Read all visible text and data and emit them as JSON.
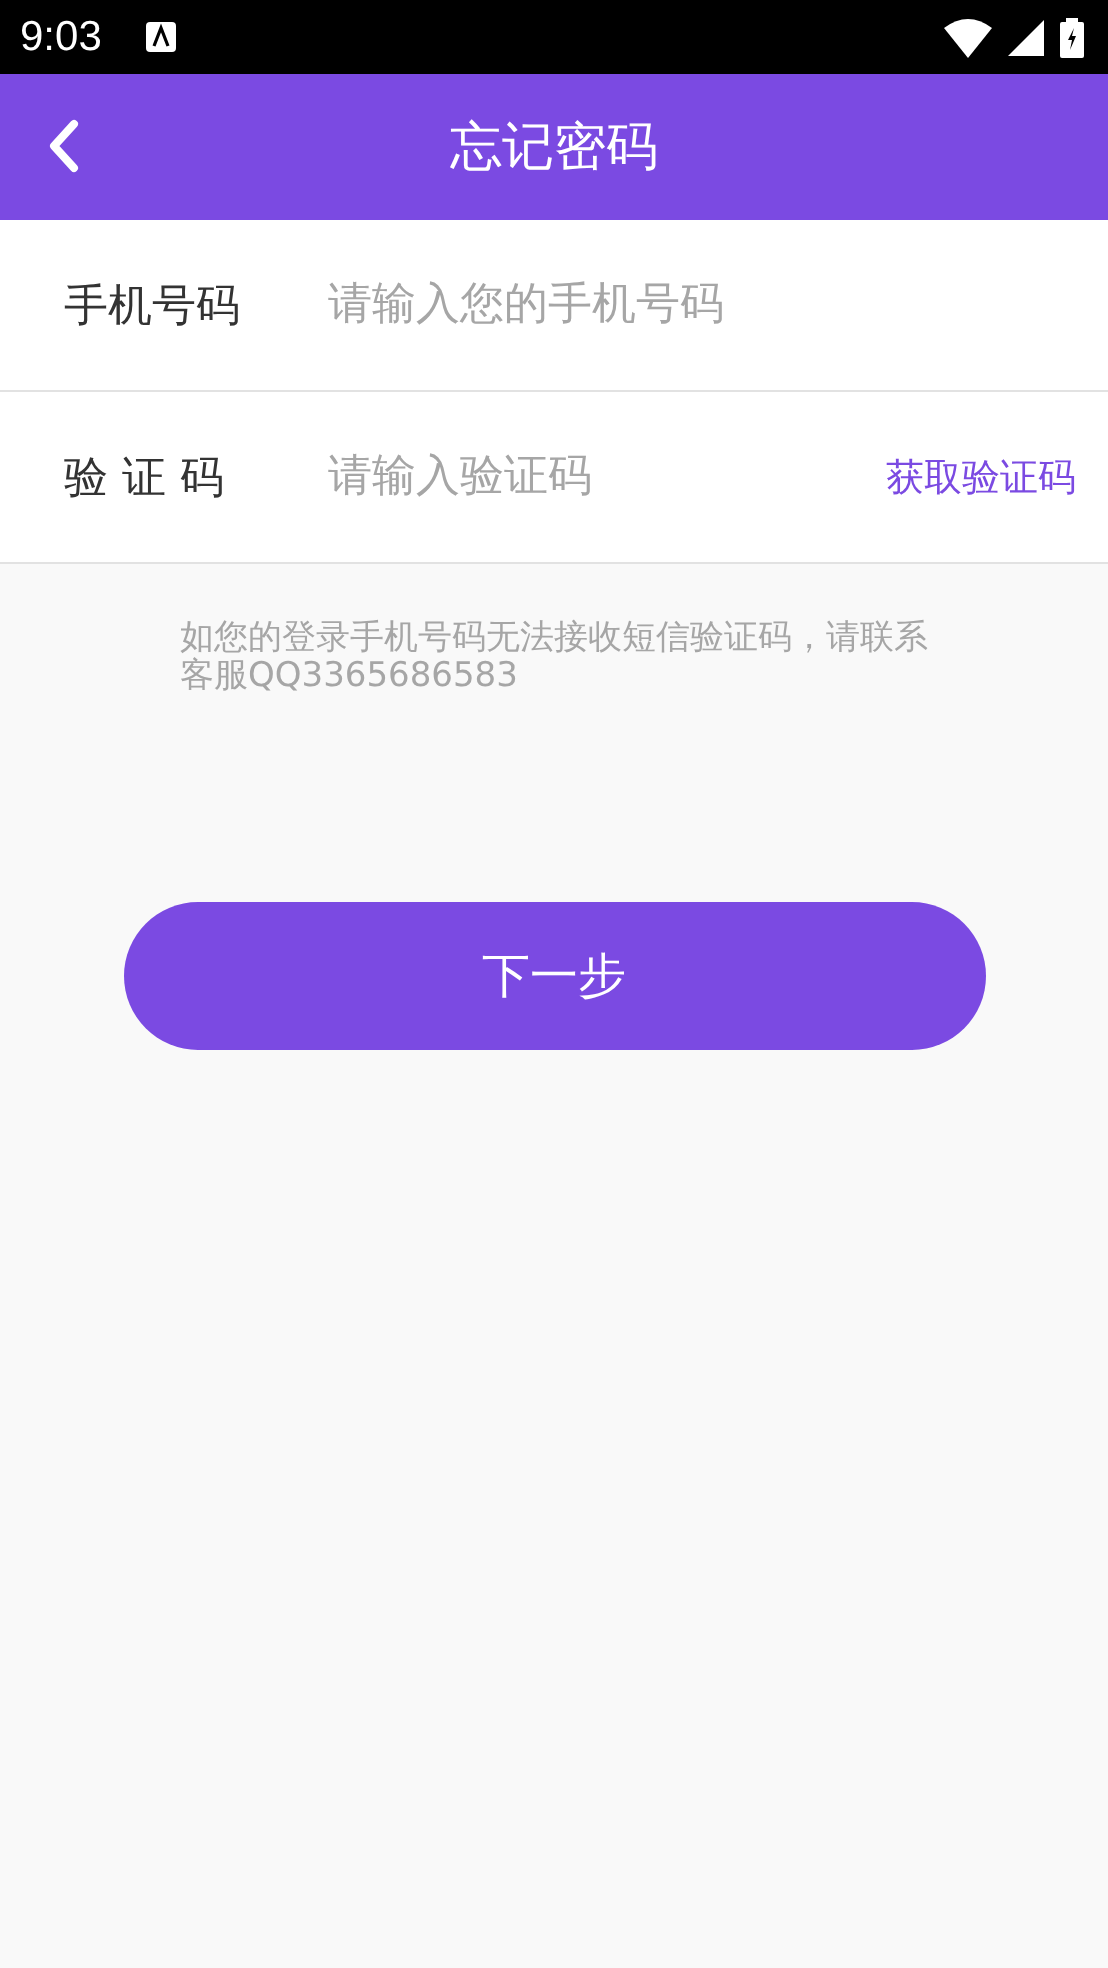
{
  "status_bar": {
    "time": "9:03"
  },
  "header": {
    "title": "忘记密码"
  },
  "fields": [
    {
      "label": "手机号码",
      "placeholder": "请输入您的手机号码"
    },
    {
      "label": "验 证 码",
      "placeholder": "请输入验证码",
      "action": "获取验证码"
    }
  ],
  "notice": "如您的登录手机号码无法接收短信验证码，请联系客服QQ3365686583",
  "next_button": "下一步"
}
